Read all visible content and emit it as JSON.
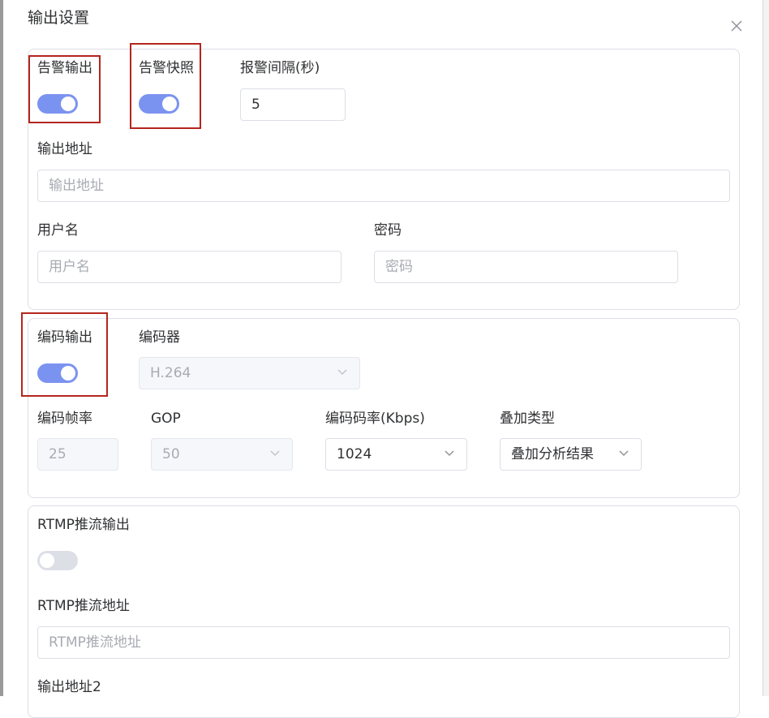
{
  "dialog": {
    "title": "输出设置"
  },
  "alarm": {
    "output_label": "告警输出",
    "output_on": true,
    "snapshot_label": "告警快照",
    "snapshot_on": true,
    "interval_label": "报警间隔(秒)",
    "interval_value": "5",
    "address_label": "输出地址",
    "address_placeholder": "输出地址",
    "username_label": "用户名",
    "username_placeholder": "用户名",
    "password_label": "密码",
    "password_placeholder": "密码"
  },
  "encoding": {
    "output_label": "编码输出",
    "output_on": true,
    "encoder_label": "编码器",
    "encoder_value": "H.264",
    "fps_label": "编码帧率",
    "fps_value": "25",
    "gop_label": "GOP",
    "gop_value": "50",
    "bitrate_label": "编码码率(Kbps)",
    "bitrate_value": "1024",
    "overlay_label": "叠加类型",
    "overlay_value": "叠加分析结果"
  },
  "rtmp": {
    "output_label": "RTMP推流输出",
    "output_on": false,
    "address_label": "RTMP推流地址",
    "address_placeholder": "RTMP推流地址",
    "address2_label": "输出地址2"
  },
  "colors": {
    "switch_on": "#7b93f0",
    "switch_off": "#dcdfe6",
    "annotation": "#b3261e"
  }
}
